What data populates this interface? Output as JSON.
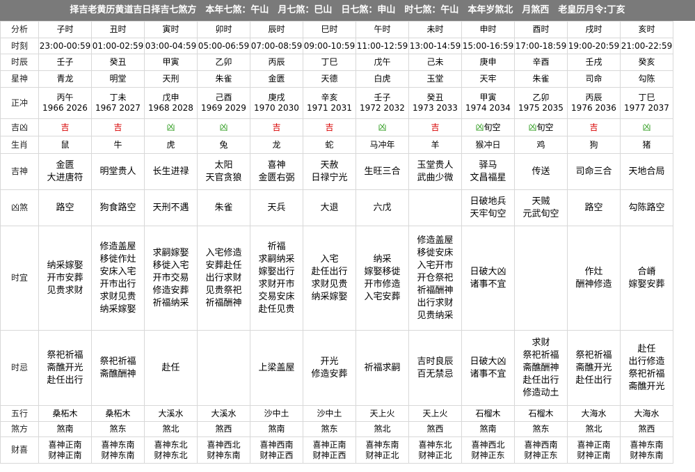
{
  "title": "择吉老黄历黄道吉日择吉七煞方　本年七煞：午山　月七煞：巳山　日七煞：申山　时七煞：午山　本年岁煞北　月煞西　老皇历月令:丁亥",
  "colors": {
    "title_bg": "#7a7a7a",
    "ji": "#d80000",
    "xiong": "#2a9a1a",
    "border": "#d8d8d8"
  },
  "labels": {
    "fenxi": "分析",
    "shike": "时刻",
    "shichen": "时辰",
    "xingshen": "星神",
    "zhengchong": "正冲",
    "jixiong": "吉凶",
    "shengxiao": "生肖",
    "jishen": "吉神",
    "xiongsha": "凶煞",
    "shiyi": "时宜",
    "shiji": "时忌",
    "wuxing": "五行",
    "shafang": "煞方",
    "caixi": "财喜"
  },
  "cols": [
    {
      "name": "子时",
      "time": "23:00-00:59",
      "ganzhi": "壬子",
      "xing": "青龙",
      "chong": "丙午",
      "years": "1966 2026",
      "jx": "吉",
      "jx_type": "ji",
      "jx_extra": "",
      "sx": "鼠",
      "jishen": [
        "金匮",
        "大进唐符"
      ],
      "xiongsha": [
        "路空"
      ],
      "yi": [
        "纳采嫁娶",
        "开市安葬",
        "见贵求财"
      ],
      "ji": [
        "祭祀祈福",
        "斋醮开光",
        "赴任出行"
      ],
      "wx": "桑柘木",
      "sf": "煞南",
      "cx1": "喜神正南",
      "cx2": "财神正南"
    },
    {
      "name": "丑时",
      "time": "01:00-02:59",
      "ganzhi": "癸丑",
      "xing": "明堂",
      "chong": "丁未",
      "years": "1967 2027",
      "jx": "吉",
      "jx_type": "ji",
      "jx_extra": "",
      "sx": "牛",
      "jishen": [
        "明堂贵人"
      ],
      "xiongsha": [
        "狗食路空"
      ],
      "yi": [
        "修造盖屋",
        "移徙作灶",
        "安床入宅",
        "开市出行",
        "求财见贵",
        "纳采嫁娶"
      ],
      "ji": [
        "祭祀祈福",
        "斋醮酬神"
      ],
      "wx": "桑柘木",
      "sf": "煞东",
      "cx1": "喜神东南",
      "cx2": "财神东南"
    },
    {
      "name": "寅时",
      "time": "03:00-04:59",
      "ganzhi": "甲寅",
      "xing": "天刑",
      "chong": "戊申",
      "years": "1968 2028",
      "jx": "凶",
      "jx_type": "xiong",
      "jx_extra": "",
      "sx": "虎",
      "jishen": [
        "长生进禄"
      ],
      "xiongsha": [
        "天刑不遇"
      ],
      "yi": [
        "求嗣嫁娶",
        "移徙入宅",
        "开市交易",
        "修造安葬",
        "祈福纳采"
      ],
      "ji": [
        "赴任"
      ],
      "wx": "大溪水",
      "sf": "煞北",
      "cx1": "喜神东北",
      "cx2": "财神东北"
    },
    {
      "name": "卯时",
      "time": "05:00-06:59",
      "ganzhi": "乙卯",
      "xing": "朱雀",
      "chong": "己酉",
      "years": "1969 2029",
      "jx": "凶",
      "jx_type": "xiong",
      "jx_extra": "",
      "sx": "兔",
      "jishen": [
        "太阳",
        "天官贪狼"
      ],
      "xiongsha": [
        "朱雀"
      ],
      "yi": [
        "入宅修造",
        "安葬赴任",
        "出行求财",
        "见贵祭祀",
        "祈福酬神"
      ],
      "ji": [],
      "wx": "大溪水",
      "sf": "煞西",
      "cx1": "喜神西北",
      "cx2": "财神东南"
    },
    {
      "name": "辰时",
      "time": "07:00-08:59",
      "ganzhi": "丙辰",
      "xing": "金匮",
      "chong": "庚戌",
      "years": "1970 2030",
      "jx": "吉",
      "jx_type": "ji",
      "jx_extra": "",
      "sx": "龙",
      "jishen": [
        "喜神",
        "金匮右弼"
      ],
      "xiongsha": [
        "天兵"
      ],
      "yi": [
        "祈福",
        "求嗣纳采",
        "嫁娶出行",
        "求财开市",
        "交易安床",
        "赴任见贵"
      ],
      "ji": [
        "上梁盖屋"
      ],
      "wx": "沙中土",
      "sf": "煞南",
      "cx1": "喜神西南",
      "cx2": "财神正西"
    },
    {
      "name": "巳时",
      "time": "09:00-10:59",
      "ganzhi": "丁巳",
      "xing": "天德",
      "chong": "辛亥",
      "years": "1971 2031",
      "jx": "吉",
      "jx_type": "ji",
      "jx_extra": "",
      "sx": "蛇",
      "jishen": [
        "天赦",
        "日禄宁光"
      ],
      "xiongsha": [
        "大退"
      ],
      "yi": [
        "入宅",
        "赴任出行",
        "求财见贵",
        "纳采嫁娶"
      ],
      "ji": [
        "开光",
        "修造安葬"
      ],
      "wx": "沙中土",
      "sf": "煞东",
      "cx1": "喜神正南",
      "cx2": "财神正西"
    },
    {
      "name": "午时",
      "time": "11:00-12:59",
      "ganzhi": "戊午",
      "xing": "白虎",
      "chong": "壬子",
      "years": "1972 2032",
      "jx": "凶",
      "jx_type": "xiong",
      "jx_extra": "",
      "sx": "马冲年",
      "jishen": [
        "生旺三合"
      ],
      "xiongsha": [
        "六戊"
      ],
      "yi": [
        "纳采",
        "嫁娶移徙",
        "开市修造",
        "入宅安葬"
      ],
      "ji": [
        "祈福求嗣"
      ],
      "wx": "天上火",
      "sf": "煞北",
      "cx1": "喜神东南",
      "cx2": "财神正北"
    },
    {
      "name": "未时",
      "time": "13:00-14:59",
      "ganzhi": "己未",
      "xing": "玉堂",
      "chong": "癸丑",
      "years": "1973 2033",
      "jx": "吉",
      "jx_type": "ji",
      "jx_extra": "",
      "sx": "羊",
      "jishen": [
        "玉堂贵人",
        "武曲少微"
      ],
      "xiongsha": [],
      "yi": [
        "修造盖屋",
        "移徙安床",
        "入宅开市",
        "开仓祭祀",
        "祈福酬神",
        "出行求财",
        "见贵纳采"
      ],
      "ji": [
        "吉时良辰",
        "百无禁忌"
      ],
      "wx": "天上火",
      "sf": "煞西",
      "cx1": "喜神东北",
      "cx2": "财神正北"
    },
    {
      "name": "申时",
      "time": "15:00-16:59",
      "ganzhi": "庚申",
      "xing": "天牢",
      "chong": "甲寅",
      "years": "1974 2034",
      "jx": "凶",
      "jx_type": "xiong",
      "jx_extra": "旬空",
      "sx": "猴冲日",
      "jishen": [
        "驿马",
        "文昌福星"
      ],
      "xiongsha": [
        "日破地兵",
        "天牢旬空"
      ],
      "yi": [
        "日破大凶",
        "诸事不宜"
      ],
      "ji": [
        "日破大凶",
        "诸事不宜"
      ],
      "wx": "石榴木",
      "sf": "煞南",
      "cx1": "喜神西北",
      "cx2": "财神正东"
    },
    {
      "name": "酉时",
      "time": "17:00-18:59",
      "ganzhi": "辛酉",
      "xing": "朱雀",
      "chong": "乙卯",
      "years": "1975 2035",
      "jx": "凶",
      "jx_type": "xiong",
      "jx_extra": "旬空",
      "sx": "鸡",
      "jishen": [
        "传送"
      ],
      "xiongsha": [
        "天贼",
        "元武旬空"
      ],
      "yi": [],
      "ji": [
        "求财",
        "祭祀祈福",
        "斋醮酬神",
        "赴任出行",
        "修造动土"
      ],
      "wx": "石榴木",
      "sf": "煞东",
      "cx1": "喜神西南",
      "cx2": "财神正东"
    },
    {
      "name": "戌时",
      "time": "19:00-20:59",
      "ganzhi": "壬戌",
      "xing": "司命",
      "chong": "丙辰",
      "years": "1976 2036",
      "jx": "吉",
      "jx_type": "ji",
      "jx_extra": "",
      "sx": "狗",
      "jishen": [
        "司命三合"
      ],
      "xiongsha": [
        "路空"
      ],
      "yi": [
        "作灶",
        "酬神修造"
      ],
      "ji": [
        "祭祀祈福",
        "斋醮开光",
        "赴任出行"
      ],
      "wx": "大海水",
      "sf": "煞北",
      "cx1": "喜神正南",
      "cx2": "财神正南"
    },
    {
      "name": "亥时",
      "time": "21:00-22:59",
      "ganzhi": "癸亥",
      "xing": "勾陈",
      "chong": "丁巳",
      "years": "1977 2037",
      "jx": "凶",
      "jx_type": "xiong",
      "jx_extra": "",
      "sx": "猪",
      "jishen": [
        "天地合局"
      ],
      "xiongsha": [
        "勾陈路空"
      ],
      "yi": [
        "合嵴",
        "嫁娶安葬"
      ],
      "ji": [
        "赴任",
        "出行修造",
        "祭祀祈福",
        "斋醮开光"
      ],
      "wx": "大海水",
      "sf": "煞西",
      "cx1": "喜神东南",
      "cx2": "财神东南"
    }
  ]
}
